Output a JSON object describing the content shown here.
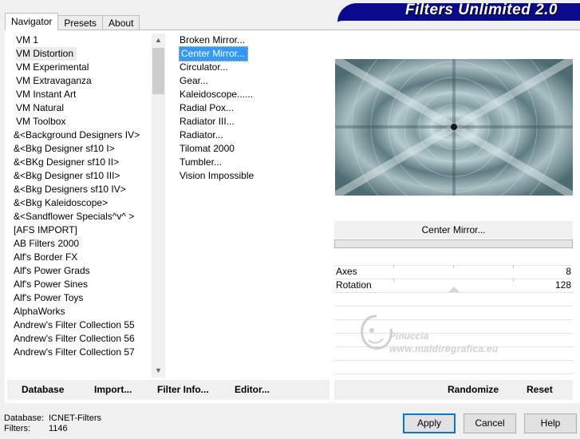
{
  "tabs": [
    {
      "label": "Navigator",
      "active": true
    },
    {
      "label": "Presets",
      "active": false
    },
    {
      "label": "About",
      "active": false
    }
  ],
  "banner": {
    "title": "Filters Unlimited 2.0"
  },
  "categories": [
    "VM 1",
    "VM Distortion",
    "VM Experimental",
    "VM Extravaganza",
    "VM Instant Art",
    "VM Natural",
    "VM Toolbox",
    "&<Background Designers IV>",
    "&<Bkg Designer sf10 I>",
    "&<BKg Designer sf10 II>",
    "&<Bkg Designer sf10 III>",
    "&<Bkg Designers sf10 IV>",
    "&<Bkg Kaleidoscope>",
    "&<Sandflower Specials^v^ >",
    "[AFS IMPORT]",
    "AB Filters 2000",
    "Alf's Border FX",
    "Alf's Power Grads",
    "Alf's Power Sines",
    "Alf's Power Toys",
    "AlphaWorks",
    "Andrew's Filter Collection 55",
    "Andrew's Filter Collection 56",
    "Andrew's Filter Collection 57"
  ],
  "selected_category": "VM Distortion",
  "filters": [
    "Broken Mirror...",
    "Center Mirror...",
    "Circulator...",
    "Gear...",
    "Kaleidoscope......",
    "Radial Pox...",
    "Radiator III...",
    "Radiator...",
    "Tilomat 2000",
    "Tumbler...",
    "Vision Impossible"
  ],
  "selected_filter": "Center Mirror...",
  "filter_name": "Center Mirror...",
  "progress": 0,
  "params": [
    {
      "label": "Axes",
      "value": "8"
    },
    {
      "label": "Rotation",
      "value": "128"
    }
  ],
  "watermark": {
    "line1": "Pinuccia",
    "line2": "www.maidiregrafica.eu"
  },
  "toolbar": {
    "database": "Database",
    "import": "Import...",
    "filter_info": "Filter Info...",
    "editor": "Editor...",
    "randomize": "Randomize",
    "reset": "Reset"
  },
  "status": {
    "database_label": "Database:",
    "database_value": "ICNET-Filters",
    "filters_label": "Filters:",
    "filters_value": "1146"
  },
  "buttons": {
    "apply": "Apply",
    "cancel": "Cancel",
    "help": "Help"
  },
  "colors": {
    "banner": "#0a0a8c",
    "selection": "#3399ff",
    "primary_border": "#0078d7"
  }
}
